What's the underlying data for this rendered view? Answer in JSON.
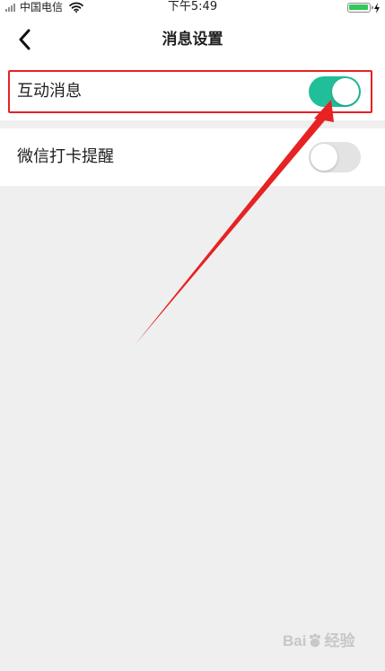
{
  "status_bar": {
    "carrier": "中国电信",
    "time": "下午5:49",
    "battery_level_percent": 90,
    "icons": [
      "signal-icon",
      "wifi-icon",
      "battery-icon",
      "charging-bolt-icon"
    ]
  },
  "nav_bar": {
    "back_icon": "chevron-left-icon",
    "title": "消息设置"
  },
  "settings": [
    {
      "label": "互动消息",
      "enabled": true
    },
    {
      "label": "微信打卡提醒",
      "enabled": false
    }
  ],
  "colors": {
    "toggle_on": "#20bf9a",
    "toggle_off": "#e3e3e3",
    "annotation_red": "#e62222",
    "page_background": "#efefef"
  },
  "watermark": {
    "text_left": "Bai",
    "text_right": "经验"
  }
}
